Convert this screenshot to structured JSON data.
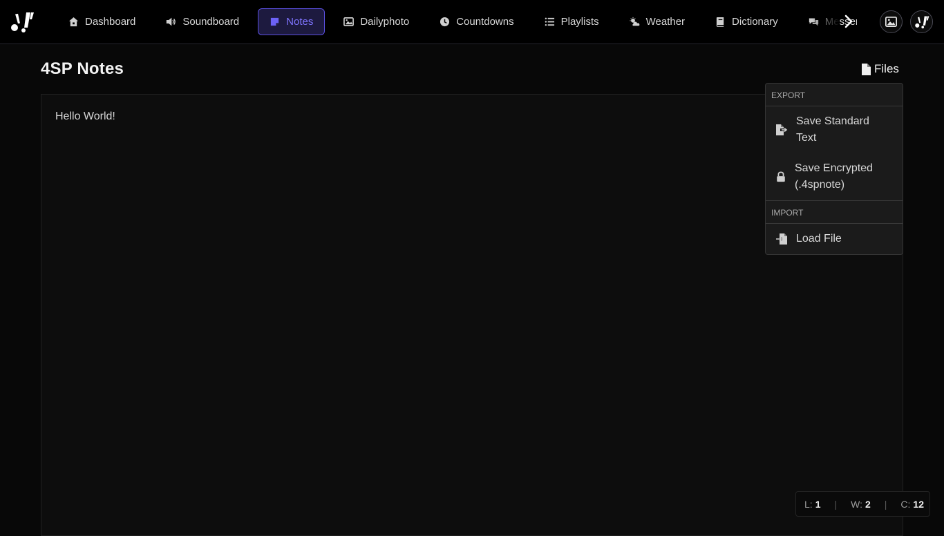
{
  "nav": {
    "items": [
      {
        "label": "Dashboard",
        "icon": "home-icon"
      },
      {
        "label": "Soundboard",
        "icon": "speaker-icon"
      },
      {
        "label": "Notes",
        "icon": "note-icon",
        "active": true
      },
      {
        "label": "Dailyphoto",
        "icon": "image-icon"
      },
      {
        "label": "Countdowns",
        "icon": "clock-icon"
      },
      {
        "label": "Playlists",
        "icon": "list-icon"
      },
      {
        "label": "Weather",
        "icon": "weather-icon"
      },
      {
        "label": "Dictionary",
        "icon": "book-icon"
      },
      {
        "label": "Messenger",
        "icon": "chat-icon"
      }
    ],
    "accent": "#5b50e0"
  },
  "page": {
    "title": "4SP Notes",
    "files_label": "Files"
  },
  "editor": {
    "content": "Hello World!"
  },
  "dropdown": {
    "export_label": "EXPORT",
    "save_standard_line1": "Save Standard",
    "save_standard_line2": "Text",
    "save_encrypted_line1": "Save Encrypted",
    "save_encrypted_line2": "(.4spnote)",
    "import_label": "IMPORT",
    "load_file": "Load File"
  },
  "stats": {
    "lines_label": "L:",
    "lines": "1",
    "words_label": "W:",
    "words": "2",
    "chars_label": "C:",
    "chars": "12"
  }
}
